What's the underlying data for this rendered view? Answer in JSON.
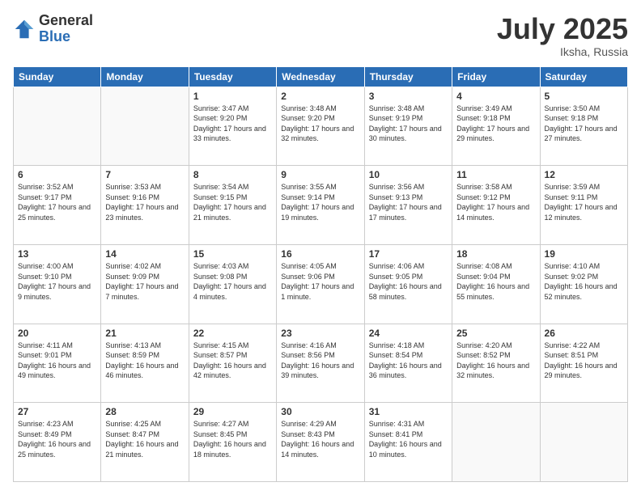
{
  "logo": {
    "general": "General",
    "blue": "Blue"
  },
  "header": {
    "month": "July 2025",
    "location": "Iksha, Russia"
  },
  "weekdays": [
    "Sunday",
    "Monday",
    "Tuesday",
    "Wednesday",
    "Thursday",
    "Friday",
    "Saturday"
  ],
  "weeks": [
    [
      {
        "day": "",
        "sunrise": "",
        "sunset": "",
        "daylight": ""
      },
      {
        "day": "",
        "sunrise": "",
        "sunset": "",
        "daylight": ""
      },
      {
        "day": "1",
        "sunrise": "Sunrise: 3:47 AM",
        "sunset": "Sunset: 9:20 PM",
        "daylight": "Daylight: 17 hours and 33 minutes."
      },
      {
        "day": "2",
        "sunrise": "Sunrise: 3:48 AM",
        "sunset": "Sunset: 9:20 PM",
        "daylight": "Daylight: 17 hours and 32 minutes."
      },
      {
        "day": "3",
        "sunrise": "Sunrise: 3:48 AM",
        "sunset": "Sunset: 9:19 PM",
        "daylight": "Daylight: 17 hours and 30 minutes."
      },
      {
        "day": "4",
        "sunrise": "Sunrise: 3:49 AM",
        "sunset": "Sunset: 9:18 PM",
        "daylight": "Daylight: 17 hours and 29 minutes."
      },
      {
        "day": "5",
        "sunrise": "Sunrise: 3:50 AM",
        "sunset": "Sunset: 9:18 PM",
        "daylight": "Daylight: 17 hours and 27 minutes."
      }
    ],
    [
      {
        "day": "6",
        "sunrise": "Sunrise: 3:52 AM",
        "sunset": "Sunset: 9:17 PM",
        "daylight": "Daylight: 17 hours and 25 minutes."
      },
      {
        "day": "7",
        "sunrise": "Sunrise: 3:53 AM",
        "sunset": "Sunset: 9:16 PM",
        "daylight": "Daylight: 17 hours and 23 minutes."
      },
      {
        "day": "8",
        "sunrise": "Sunrise: 3:54 AM",
        "sunset": "Sunset: 9:15 PM",
        "daylight": "Daylight: 17 hours and 21 minutes."
      },
      {
        "day": "9",
        "sunrise": "Sunrise: 3:55 AM",
        "sunset": "Sunset: 9:14 PM",
        "daylight": "Daylight: 17 hours and 19 minutes."
      },
      {
        "day": "10",
        "sunrise": "Sunrise: 3:56 AM",
        "sunset": "Sunset: 9:13 PM",
        "daylight": "Daylight: 17 hours and 17 minutes."
      },
      {
        "day": "11",
        "sunrise": "Sunrise: 3:58 AM",
        "sunset": "Sunset: 9:12 PM",
        "daylight": "Daylight: 17 hours and 14 minutes."
      },
      {
        "day": "12",
        "sunrise": "Sunrise: 3:59 AM",
        "sunset": "Sunset: 9:11 PM",
        "daylight": "Daylight: 17 hours and 12 minutes."
      }
    ],
    [
      {
        "day": "13",
        "sunrise": "Sunrise: 4:00 AM",
        "sunset": "Sunset: 9:10 PM",
        "daylight": "Daylight: 17 hours and 9 minutes."
      },
      {
        "day": "14",
        "sunrise": "Sunrise: 4:02 AM",
        "sunset": "Sunset: 9:09 PM",
        "daylight": "Daylight: 17 hours and 7 minutes."
      },
      {
        "day": "15",
        "sunrise": "Sunrise: 4:03 AM",
        "sunset": "Sunset: 9:08 PM",
        "daylight": "Daylight: 17 hours and 4 minutes."
      },
      {
        "day": "16",
        "sunrise": "Sunrise: 4:05 AM",
        "sunset": "Sunset: 9:06 PM",
        "daylight": "Daylight: 17 hours and 1 minute."
      },
      {
        "day": "17",
        "sunrise": "Sunrise: 4:06 AM",
        "sunset": "Sunset: 9:05 PM",
        "daylight": "Daylight: 16 hours and 58 minutes."
      },
      {
        "day": "18",
        "sunrise": "Sunrise: 4:08 AM",
        "sunset": "Sunset: 9:04 PM",
        "daylight": "Daylight: 16 hours and 55 minutes."
      },
      {
        "day": "19",
        "sunrise": "Sunrise: 4:10 AM",
        "sunset": "Sunset: 9:02 PM",
        "daylight": "Daylight: 16 hours and 52 minutes."
      }
    ],
    [
      {
        "day": "20",
        "sunrise": "Sunrise: 4:11 AM",
        "sunset": "Sunset: 9:01 PM",
        "daylight": "Daylight: 16 hours and 49 minutes."
      },
      {
        "day": "21",
        "sunrise": "Sunrise: 4:13 AM",
        "sunset": "Sunset: 8:59 PM",
        "daylight": "Daylight: 16 hours and 46 minutes."
      },
      {
        "day": "22",
        "sunrise": "Sunrise: 4:15 AM",
        "sunset": "Sunset: 8:57 PM",
        "daylight": "Daylight: 16 hours and 42 minutes."
      },
      {
        "day": "23",
        "sunrise": "Sunrise: 4:16 AM",
        "sunset": "Sunset: 8:56 PM",
        "daylight": "Daylight: 16 hours and 39 minutes."
      },
      {
        "day": "24",
        "sunrise": "Sunrise: 4:18 AM",
        "sunset": "Sunset: 8:54 PM",
        "daylight": "Daylight: 16 hours and 36 minutes."
      },
      {
        "day": "25",
        "sunrise": "Sunrise: 4:20 AM",
        "sunset": "Sunset: 8:52 PM",
        "daylight": "Daylight: 16 hours and 32 minutes."
      },
      {
        "day": "26",
        "sunrise": "Sunrise: 4:22 AM",
        "sunset": "Sunset: 8:51 PM",
        "daylight": "Daylight: 16 hours and 29 minutes."
      }
    ],
    [
      {
        "day": "27",
        "sunrise": "Sunrise: 4:23 AM",
        "sunset": "Sunset: 8:49 PM",
        "daylight": "Daylight: 16 hours and 25 minutes."
      },
      {
        "day": "28",
        "sunrise": "Sunrise: 4:25 AM",
        "sunset": "Sunset: 8:47 PM",
        "daylight": "Daylight: 16 hours and 21 minutes."
      },
      {
        "day": "29",
        "sunrise": "Sunrise: 4:27 AM",
        "sunset": "Sunset: 8:45 PM",
        "daylight": "Daylight: 16 hours and 18 minutes."
      },
      {
        "day": "30",
        "sunrise": "Sunrise: 4:29 AM",
        "sunset": "Sunset: 8:43 PM",
        "daylight": "Daylight: 16 hours and 14 minutes."
      },
      {
        "day": "31",
        "sunrise": "Sunrise: 4:31 AM",
        "sunset": "Sunset: 8:41 PM",
        "daylight": "Daylight: 16 hours and 10 minutes."
      },
      {
        "day": "",
        "sunrise": "",
        "sunset": "",
        "daylight": ""
      },
      {
        "day": "",
        "sunrise": "",
        "sunset": "",
        "daylight": ""
      }
    ]
  ]
}
